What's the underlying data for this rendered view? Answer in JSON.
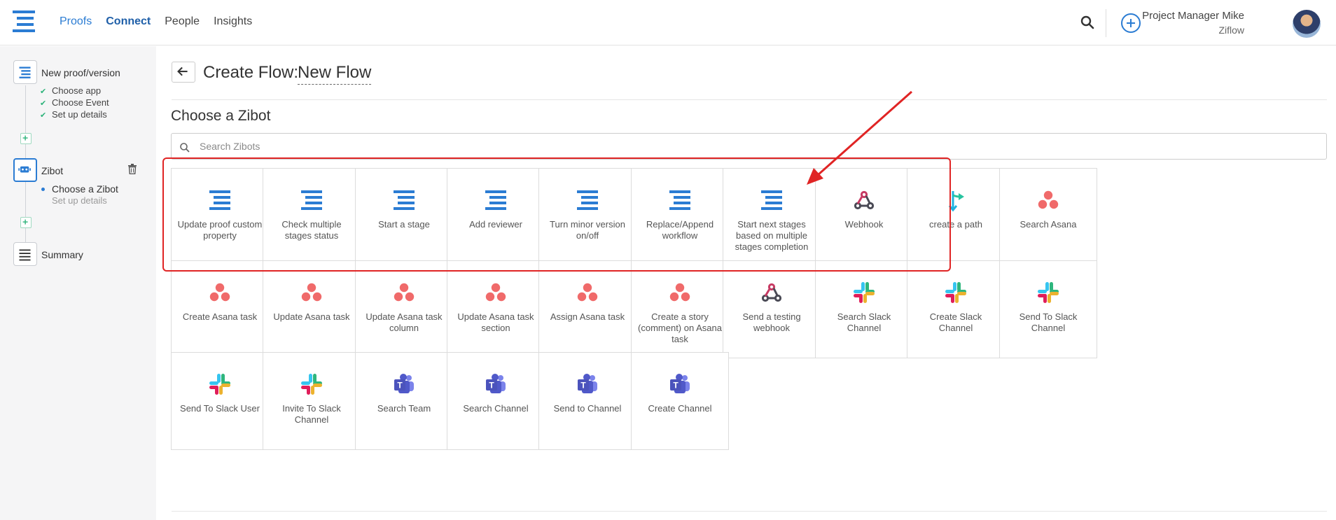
{
  "nav": {
    "items": [
      "Proofs",
      "Connect",
      "People",
      "Insights"
    ]
  },
  "user": {
    "name": "Project Manager Mike",
    "org": "Ziflow"
  },
  "sidebar": {
    "step1": {
      "title": "New proof/version",
      "subs": [
        "Choose app",
        "Choose Event",
        "Set up details"
      ]
    },
    "step2": {
      "title": "Zibot",
      "subs": [
        "Choose a Zibot",
        "Set up details"
      ]
    },
    "step3": {
      "title": "Summary"
    }
  },
  "header": {
    "title": "Create Flow:",
    "flow_name": "New Flow"
  },
  "section": {
    "title": "Choose a Zibot"
  },
  "search": {
    "placeholder": "Search Zibots"
  },
  "colors": {
    "accent": "#2b7cd3",
    "highlight": "#e02424",
    "success": "#2db37a"
  },
  "cards": [
    {
      "label": "Update proof custom property",
      "icon": "ziflow-icon"
    },
    {
      "label": "Check multiple stages status",
      "icon": "ziflow-icon"
    },
    {
      "label": "Start a stage",
      "icon": "ziflow-icon"
    },
    {
      "label": "Add reviewer",
      "icon": "ziflow-icon"
    },
    {
      "label": "Turn minor version on/off",
      "icon": "ziflow-icon"
    },
    {
      "label": "Replace/Append workflow",
      "icon": "ziflow-icon"
    },
    {
      "label": "Start next stages based on multiple stages completion",
      "icon": "ziflow-icon"
    },
    {
      "label": "Webhook",
      "icon": "webhook-icon"
    },
    {
      "label": "create a path",
      "icon": "path-icon"
    },
    {
      "label": "Search Asana",
      "icon": "asana-icon"
    },
    {
      "label": "Create Asana task",
      "icon": "asana-icon"
    },
    {
      "label": "Update Asana task",
      "icon": "asana-icon"
    },
    {
      "label": "Update Asana task column",
      "icon": "asana-icon"
    },
    {
      "label": "Update Asana task section",
      "icon": "asana-icon"
    },
    {
      "label": "Assign Asana task",
      "icon": "asana-icon"
    },
    {
      "label": "Create a story (comment) on Asana task",
      "icon": "asana-icon"
    },
    {
      "label": "Send a testing webhook",
      "icon": "webhook-icon"
    },
    {
      "label": "Search Slack Channel",
      "icon": "slack-icon"
    },
    {
      "label": "Create Slack Channel",
      "icon": "slack-icon"
    },
    {
      "label": "Send To Slack Channel",
      "icon": "slack-icon"
    },
    {
      "label": "Send To Slack User",
      "icon": "slack-icon"
    },
    {
      "label": "Invite To Slack Channel",
      "icon": "slack-icon"
    },
    {
      "label": "Search Team",
      "icon": "teams-icon"
    },
    {
      "label": "Search Channel",
      "icon": "teams-icon"
    },
    {
      "label": "Send to Channel",
      "icon": "teams-icon"
    },
    {
      "label": "Create Channel",
      "icon": "teams-icon"
    }
  ]
}
